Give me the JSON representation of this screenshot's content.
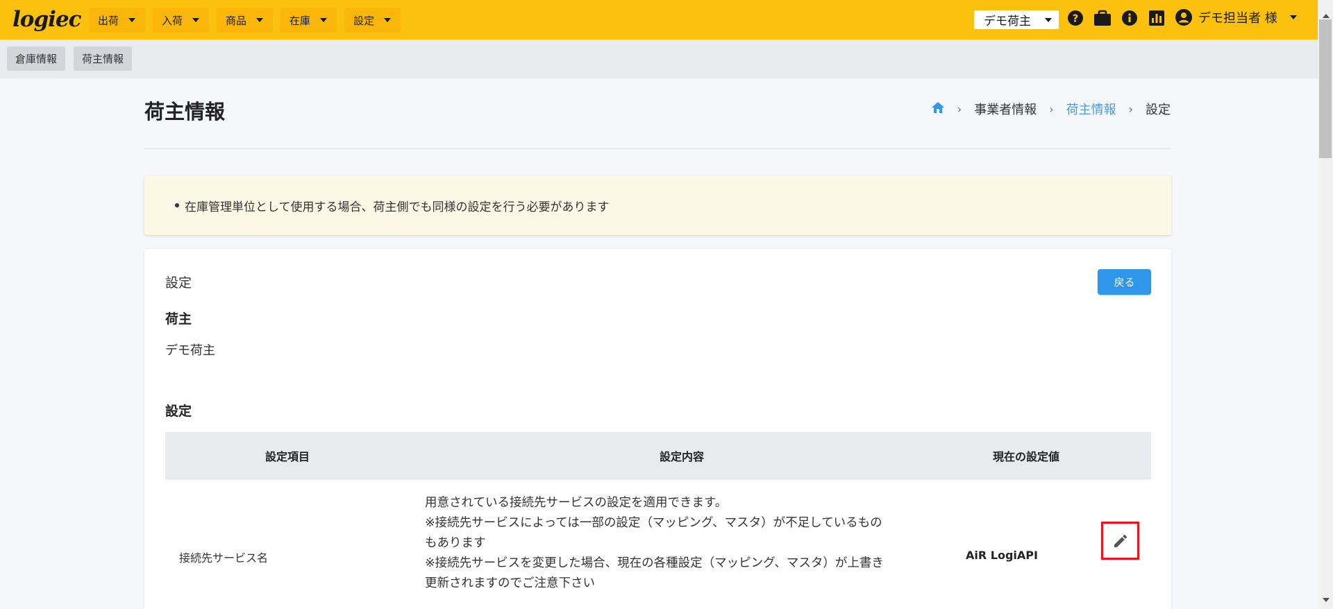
{
  "header": {
    "logo_text": "logiec",
    "nav": [
      {
        "label": "出荷"
      },
      {
        "label": "入荷"
      },
      {
        "label": "商品"
      },
      {
        "label": "在庫"
      },
      {
        "label": "設定"
      }
    ],
    "shipper_select": "デモ荷主",
    "user_name": "デモ担当者 様",
    "icons": [
      "help-icon",
      "briefcase-icon",
      "info-icon",
      "chart-icon",
      "user-icon"
    ],
    "accent_color": "#fcc10f"
  },
  "subnav": {
    "tabs": [
      {
        "label": "倉庫情報"
      },
      {
        "label": "荷主情報"
      }
    ]
  },
  "page": {
    "title": "荷主情報",
    "breadcrumb": {
      "home_icon": "home-icon",
      "items": [
        "事業者情報",
        "荷主情報",
        "設定"
      ]
    }
  },
  "alert": {
    "message": "在庫管理単位として使用する場合、荷主側でも同様の設定を行う必要があります"
  },
  "card": {
    "title": "設定",
    "back_button": "戻る",
    "shipper_section_label": "荷主",
    "shipper_name": "デモ荷主",
    "settings_section_label": "設定",
    "table": {
      "headers": [
        "設定項目",
        "設定内容",
        "現在の設定値"
      ],
      "rows": [
        {
          "item": "接続先サービス名",
          "description_lines": [
            "用意されている接続先サービスの設定を適用できます。",
            "※接続先サービスによっては一部の設定（マッピング、マスタ）が不足しているもの",
            "もあります",
            "※接続先サービスを変更した場合、現在の各種設定（マッピング、マスタ）が上書き",
            "更新されますのでご注意下さい"
          ],
          "value": "AiR LogiAPI",
          "action_icon": "pencil-icon"
        }
      ]
    }
  }
}
